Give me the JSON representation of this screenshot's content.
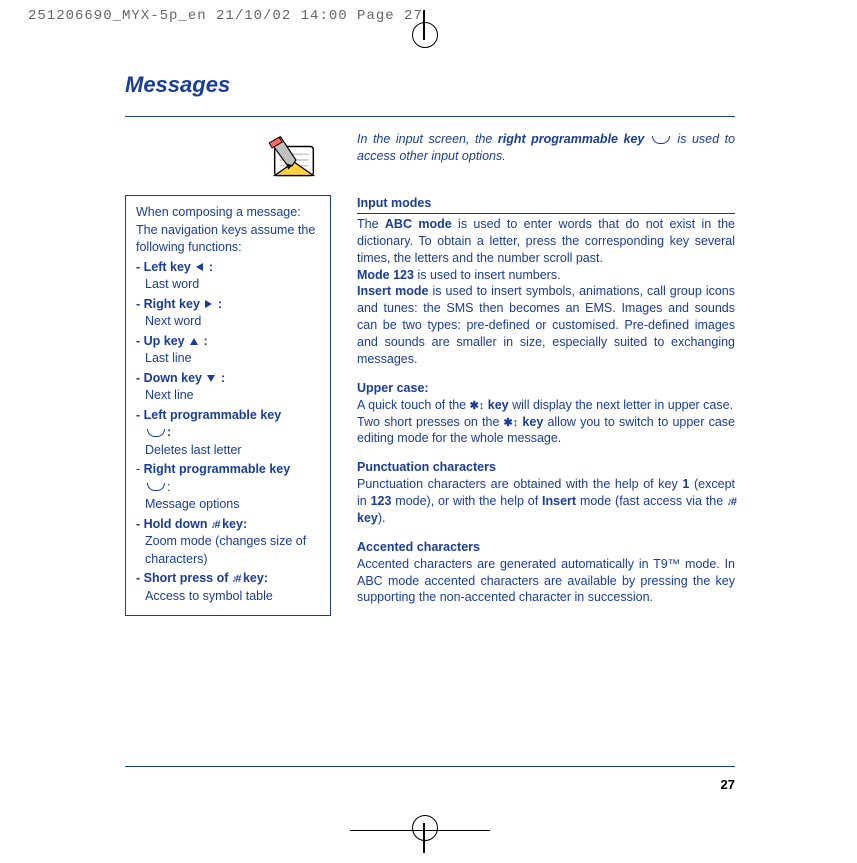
{
  "header_info": "251206690_MYX-5p_en  21/10/02  14:00  Page 27",
  "page_title": "Messages",
  "intro": {
    "pre": "In the input screen, the ",
    "key": "right programmable key",
    "post": " is used to access other input options."
  },
  "sidebar": {
    "intro": "When composing a message: The navigation keys assume the following functions:",
    "items": [
      {
        "label": "- Left key",
        "arrow": "left",
        "colon": " :",
        "desc": "Last word"
      },
      {
        "label": "- Right key",
        "arrow": "right",
        "colon": " :",
        "desc": "Next word"
      },
      {
        "label": "- Up key",
        "arrow": "up",
        "colon": " :",
        "desc": "Last line"
      },
      {
        "label": "- Down key",
        "arrow": "down",
        "colon": " :",
        "desc": "Next line"
      }
    ],
    "left_prog": {
      "label": "- Left programmable key",
      "colon": ":",
      "desc": "Deletes last letter"
    },
    "right_prog": {
      "label_dash": "- ",
      "label": "Right programmable key",
      "colon": ":",
      "desc": "Message options"
    },
    "hold": {
      "label": "- Hold down",
      "key": " key:",
      "desc": "Zoom mode (changes size of characters)"
    },
    "short": {
      "label": "- Short press of",
      "key": " key:",
      "desc": "Access to symbol table"
    }
  },
  "main": {
    "input_modes": {
      "heading": "Input modes",
      "p1_pre": "The ",
      "abc": "ABC mode",
      "p1_post": " is used to enter words that do not exist in the dictionary. To obtain a letter, press the corresponding key several times, the letters and the number scroll past.",
      "mode123_b": "Mode 123",
      "mode123_t": " is used to insert numbers.",
      "insert_b": "Insert mode",
      "insert_t": " is used to insert symbols, animations, call group icons and tunes: the SMS then becomes an EMS. Images and sounds can be two types: pre-defined or customised. Pre-defined images and sounds are smaller in size, especially suited to exchanging messages."
    },
    "upper": {
      "heading": "Upper case:",
      "p1_pre": "A quick touch of the ",
      "p1_key": " key",
      "p1_post": " will display the next letter in upper case.",
      "p2_pre": "Two short presses on the ",
      "p2_key": " key",
      "p2_post": " allow you to switch to upper case editing mode for the whole message."
    },
    "punct": {
      "heading": "Punctuation characters",
      "p_pre": "Punctuation characters are obtained with the help of key ",
      "one": "1",
      "p_mid1": " (except in ",
      "m123": "123",
      "p_mid2": " mode), or with the help of ",
      "insert": "Insert",
      "p_mid3": " mode (fast access via the ",
      "key": " key",
      "p_post": ")."
    },
    "accent": {
      "heading": "Accented characters",
      "p": "Accented characters are generated automatically in T9™ mode. In ABC mode accented characters are available by pressing the key supporting the non-accented character in succession."
    }
  },
  "page_number": "27"
}
